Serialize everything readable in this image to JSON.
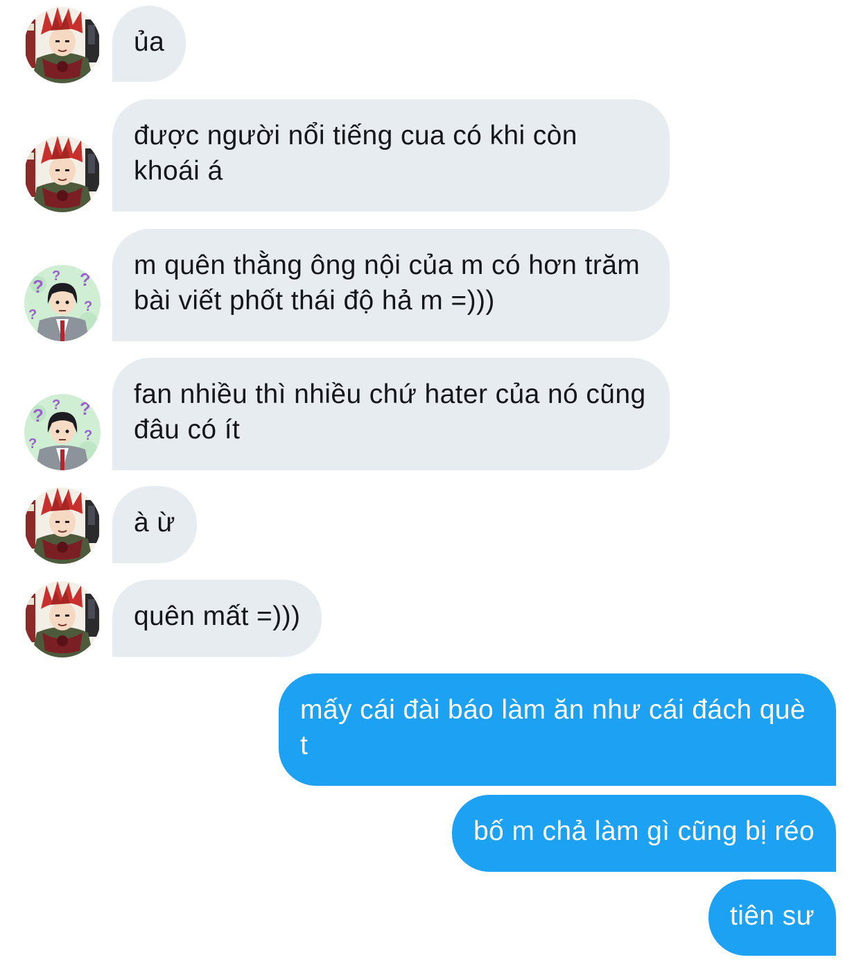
{
  "colors": {
    "incoming_bubble": "#e6ecf0",
    "incoming_text": "#14171a",
    "outgoing_bubble": "#1da1f2",
    "outgoing_text": "#ffffff"
  },
  "avatars": {
    "red_hair_user": "avatar-red-spiky-hair",
    "black_hair_user": "avatar-black-hair-question-marks"
  },
  "messages": [
    {
      "sender": "red_hair_user",
      "text": "ủa"
    },
    {
      "sender": "red_hair_user",
      "text": "được người nổi tiếng cua có khi còn khoái á"
    },
    {
      "sender": "black_hair_user",
      "text": "m quên thằng ông nội của m có hơn trăm bài viết phốt thái độ hả m =)))"
    },
    {
      "sender": "black_hair_user",
      "text": "fan nhiều thì nhiều chứ hater của nó cũng đâu có ít"
    },
    {
      "sender": "red_hair_user",
      "text": "à ừ"
    },
    {
      "sender": "red_hair_user",
      "text": "quên mất =)))"
    },
    {
      "sender": "me",
      "text": "mấy cái đài báo làm ăn như cái đách què t"
    },
    {
      "sender": "me",
      "text": "bố m chả làm gì cũng bị réo"
    },
    {
      "sender": "me",
      "text": "tiên sư"
    }
  ]
}
